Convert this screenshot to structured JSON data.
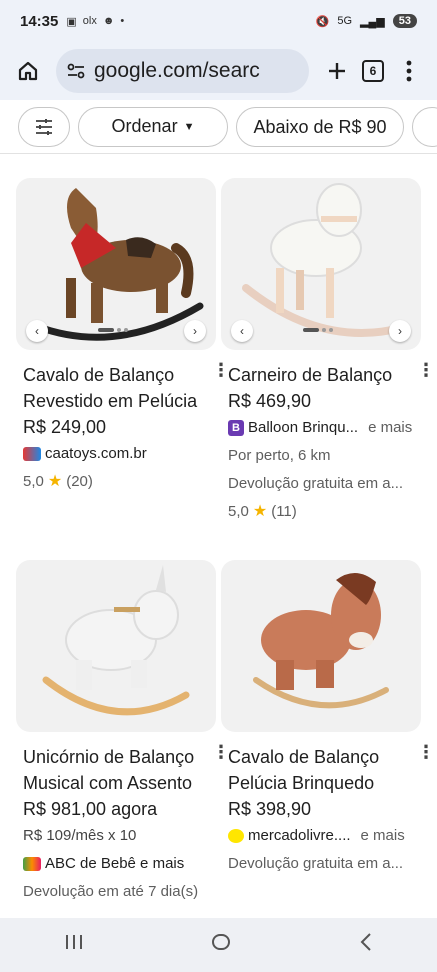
{
  "status": {
    "time": "14:35",
    "network": "5G",
    "battery": "53"
  },
  "toolbar": {
    "url": "google.com/searc",
    "tab_count": "6"
  },
  "chips": {
    "sort": "Ordenar",
    "price": "Abaixo de R$ 90"
  },
  "products": [
    {
      "title": "Cavalo de Balanço Revestido em Pelúcia",
      "price": "R$ 249,00",
      "seller": "caatoys.com.br",
      "rating": "5,0",
      "reviews": "(20)"
    },
    {
      "title": "Carneiro de Balanço",
      "price": "R$ 469,90",
      "seller": "Balloon Brinqu...",
      "seller_more": "e mais",
      "distance": "Por perto, 6 km",
      "returns": "Devolução gratuita em a...",
      "rating": "5,0",
      "reviews": "(11)"
    },
    {
      "title": "Unicórnio de Balanço Musical com Assento",
      "price": "R$ 981,00 agora",
      "installments": "R$ 109/mês x 10",
      "seller": "ABC de Bebê e mais",
      "returns": "Devolução em até 7 dia(s)"
    },
    {
      "title": "Cavalo de Balanço Pelúcia Brinquedo",
      "price": "R$ 398,90",
      "seller": "mercadolivre....",
      "seller_more": "e mais",
      "returns": "Devolução gratuita em a..."
    }
  ],
  "colors": {
    "accent_star": "#f5b400",
    "toolbar_bg": "#eef2f9"
  }
}
